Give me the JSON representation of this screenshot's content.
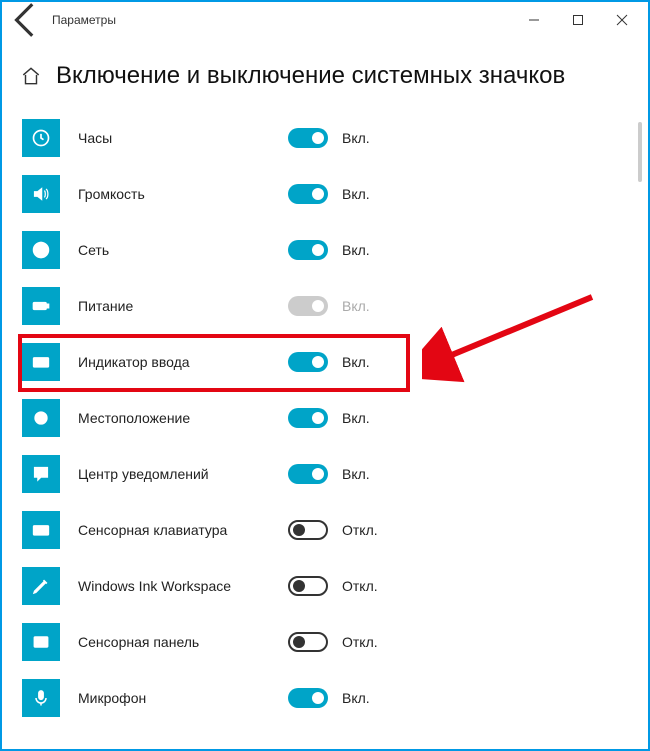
{
  "window": {
    "title": "Параметры"
  },
  "page": {
    "heading": "Включение и выключение системных значков"
  },
  "labels": {
    "on": "Вкл.",
    "off": "Откл."
  },
  "items": [
    {
      "id": "clock",
      "label": "Часы",
      "icon": "clock",
      "state": "on"
    },
    {
      "id": "volume",
      "label": "Громкость",
      "icon": "volume",
      "state": "on"
    },
    {
      "id": "network",
      "label": "Сеть",
      "icon": "globe",
      "state": "on"
    },
    {
      "id": "power",
      "label": "Питание",
      "icon": "battery",
      "state": "disabled"
    },
    {
      "id": "input",
      "label": "Индикатор ввода",
      "icon": "keyboard",
      "state": "on",
      "highlighted": true
    },
    {
      "id": "location",
      "label": "Местоположение",
      "icon": "target",
      "state": "on"
    },
    {
      "id": "actioncenter",
      "label": "Центр уведомлений",
      "icon": "action",
      "state": "on"
    },
    {
      "id": "touchkeyboard",
      "label": "Сенсорная клавиатура",
      "icon": "keyboard",
      "state": "off"
    },
    {
      "id": "ink",
      "label": "Windows Ink Workspace",
      "icon": "pen",
      "state": "off"
    },
    {
      "id": "touchpad",
      "label": "Сенсорная панель",
      "icon": "touchpad",
      "state": "off"
    },
    {
      "id": "microphone",
      "label": "Микрофон",
      "icon": "mic",
      "state": "on"
    }
  ]
}
